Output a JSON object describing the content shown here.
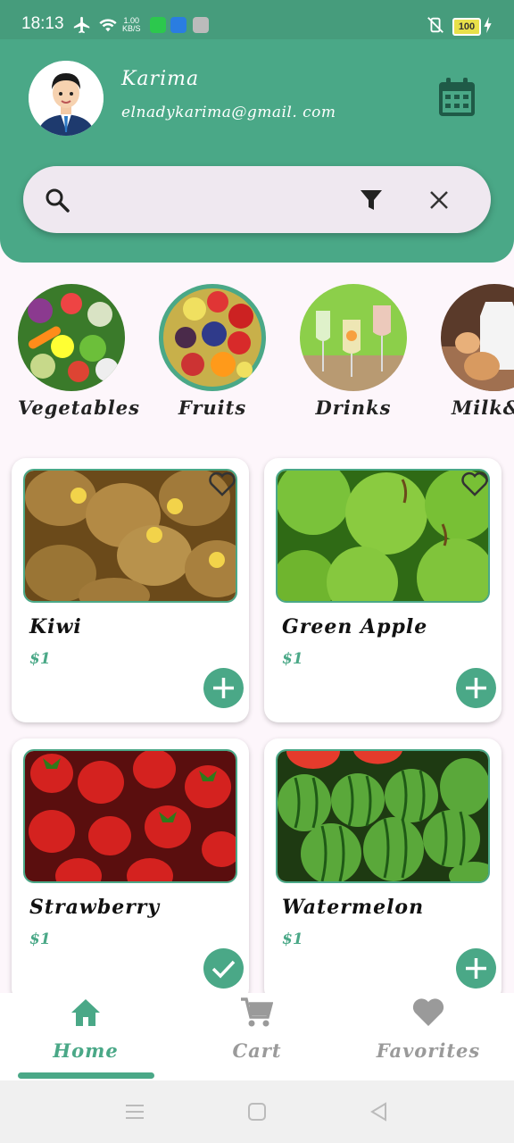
{
  "status_bar": {
    "time": "18:13",
    "net_speed_value": "1.00",
    "net_speed_unit": "KB/S",
    "battery": "100"
  },
  "header": {
    "user_name": "Karima",
    "user_email": "elnadykarima@gmail. com"
  },
  "search": {
    "placeholder": ""
  },
  "categories": [
    {
      "label": "Vegetables"
    },
    {
      "label": "Fruits",
      "selected": true
    },
    {
      "label": "Drinks"
    },
    {
      "label": "Milk&E"
    }
  ],
  "products": [
    {
      "name": "Kiwi",
      "price": "$1",
      "in_cart": false,
      "favorite": false
    },
    {
      "name": "Green Apple",
      "price": "$1",
      "in_cart": false,
      "favorite": false
    },
    {
      "name": "Strawberry",
      "price": "$1",
      "in_cart": true
    },
    {
      "name": "Watermelon",
      "price": "$1",
      "in_cart": false
    }
  ],
  "bottom_nav": [
    {
      "label": "Home",
      "active": true
    },
    {
      "label": "Cart",
      "active": false
    },
    {
      "label": "Favorites",
      "active": false
    }
  ],
  "colors": {
    "primary": "#4aa887",
    "status_bar": "#469c7c",
    "background": "#fdf6fb",
    "inactive": "#9a9a9a"
  }
}
